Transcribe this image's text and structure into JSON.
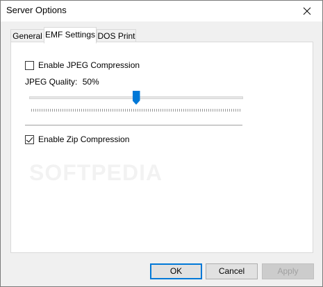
{
  "window": {
    "title": "Server Options"
  },
  "tabs": [
    {
      "label": "General",
      "active": false
    },
    {
      "label": "EMF Settings",
      "active": true
    },
    {
      "label": "DOS Print",
      "active": false
    }
  ],
  "emf": {
    "jpeg_compression_label": "Enable JPEG Compression",
    "jpeg_compression_checked": false,
    "jpeg_quality_label": "JPEG Quality:",
    "jpeg_quality_value": "50%",
    "jpeg_quality_fraction": 0.5,
    "zip_compression_label": "Enable Zip Compression",
    "zip_compression_checked": true
  },
  "watermark": "SOFTPEDIA",
  "buttons": {
    "ok": "OK",
    "cancel": "Cancel",
    "apply": "Apply"
  },
  "colors": {
    "accent": "#0078d7"
  }
}
